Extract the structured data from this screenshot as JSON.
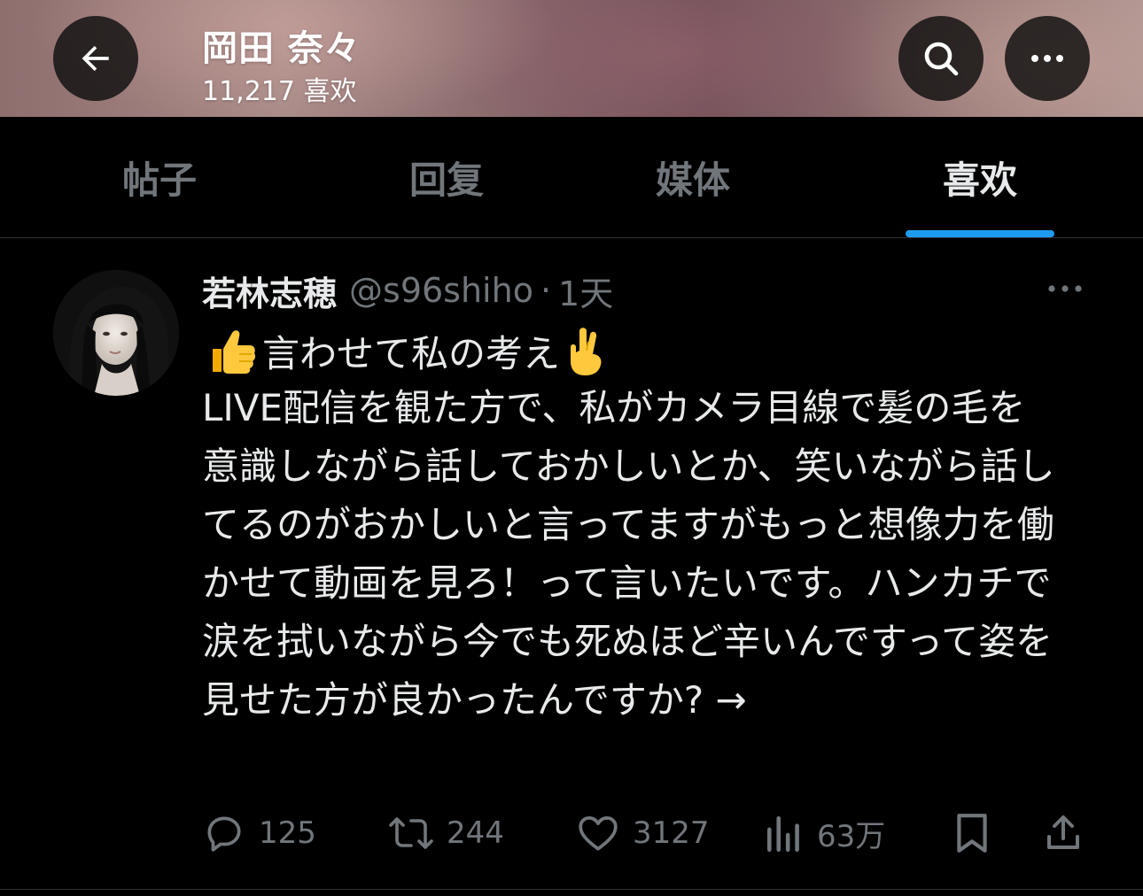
{
  "header": {
    "title": "岡田 奈々",
    "subtitle": "11,217 喜欢"
  },
  "tabs": [
    {
      "label": "帖子",
      "active": false
    },
    {
      "label": "回复",
      "active": false
    },
    {
      "label": "媒体",
      "active": false
    },
    {
      "label": "喜欢",
      "active": true
    }
  ],
  "tweet": {
    "display_name": "若林志穂",
    "handle": "@s96shiho",
    "separator": "·",
    "time": "1天",
    "line1_emoji_left": "thumbs-up-icon",
    "line1_text": "言わせて私の考え",
    "line1_emoji_right": "crossed-fingers-icon",
    "body": "LIVE配信を観た方で、私がカメラ目線で髪の毛を意識しながら話しておかしいとか、笑いながら話してるのがおかしいと言ってますがもっと想像力を働かせて動画を見ろ！って言いたいです。ハンカチで涙を拭いながら今でも死ぬほど辛いんですって姿を見せた方が良かったんですか? →"
  },
  "actions": {
    "replies": "125",
    "retweets": "244",
    "likes": "3127",
    "views": "63万"
  },
  "colors": {
    "background": "#000000",
    "text_primary": "#e7e9ea",
    "text_secondary": "#71767b",
    "accent": "#1d9bf0",
    "divider": "#2f3336"
  }
}
